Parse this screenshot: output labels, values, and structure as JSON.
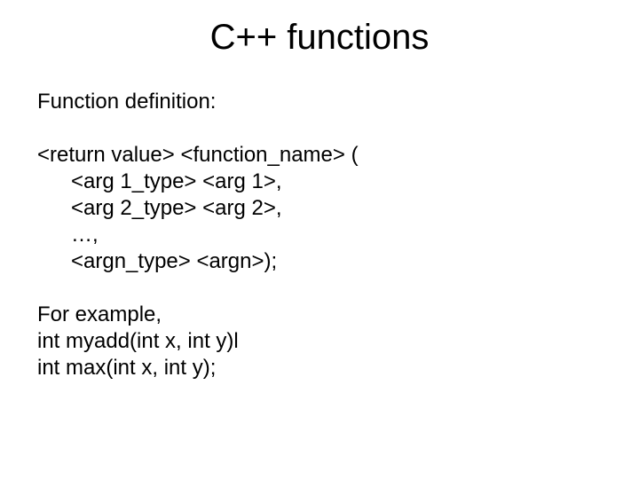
{
  "title": "C++ functions",
  "heading": "Function definition:",
  "syntax": {
    "line1": "<return value> <function_name> (",
    "line2": "<arg 1_type> <arg 1>,",
    "line3": "<arg 2_type> <arg 2>,",
    "line4": "…,",
    "line5": "<argn_type> <argn>);"
  },
  "example": {
    "line1": "For example,",
    "line2": "int myadd(int x, int y)l",
    "line3": "int max(int x, int y);"
  }
}
